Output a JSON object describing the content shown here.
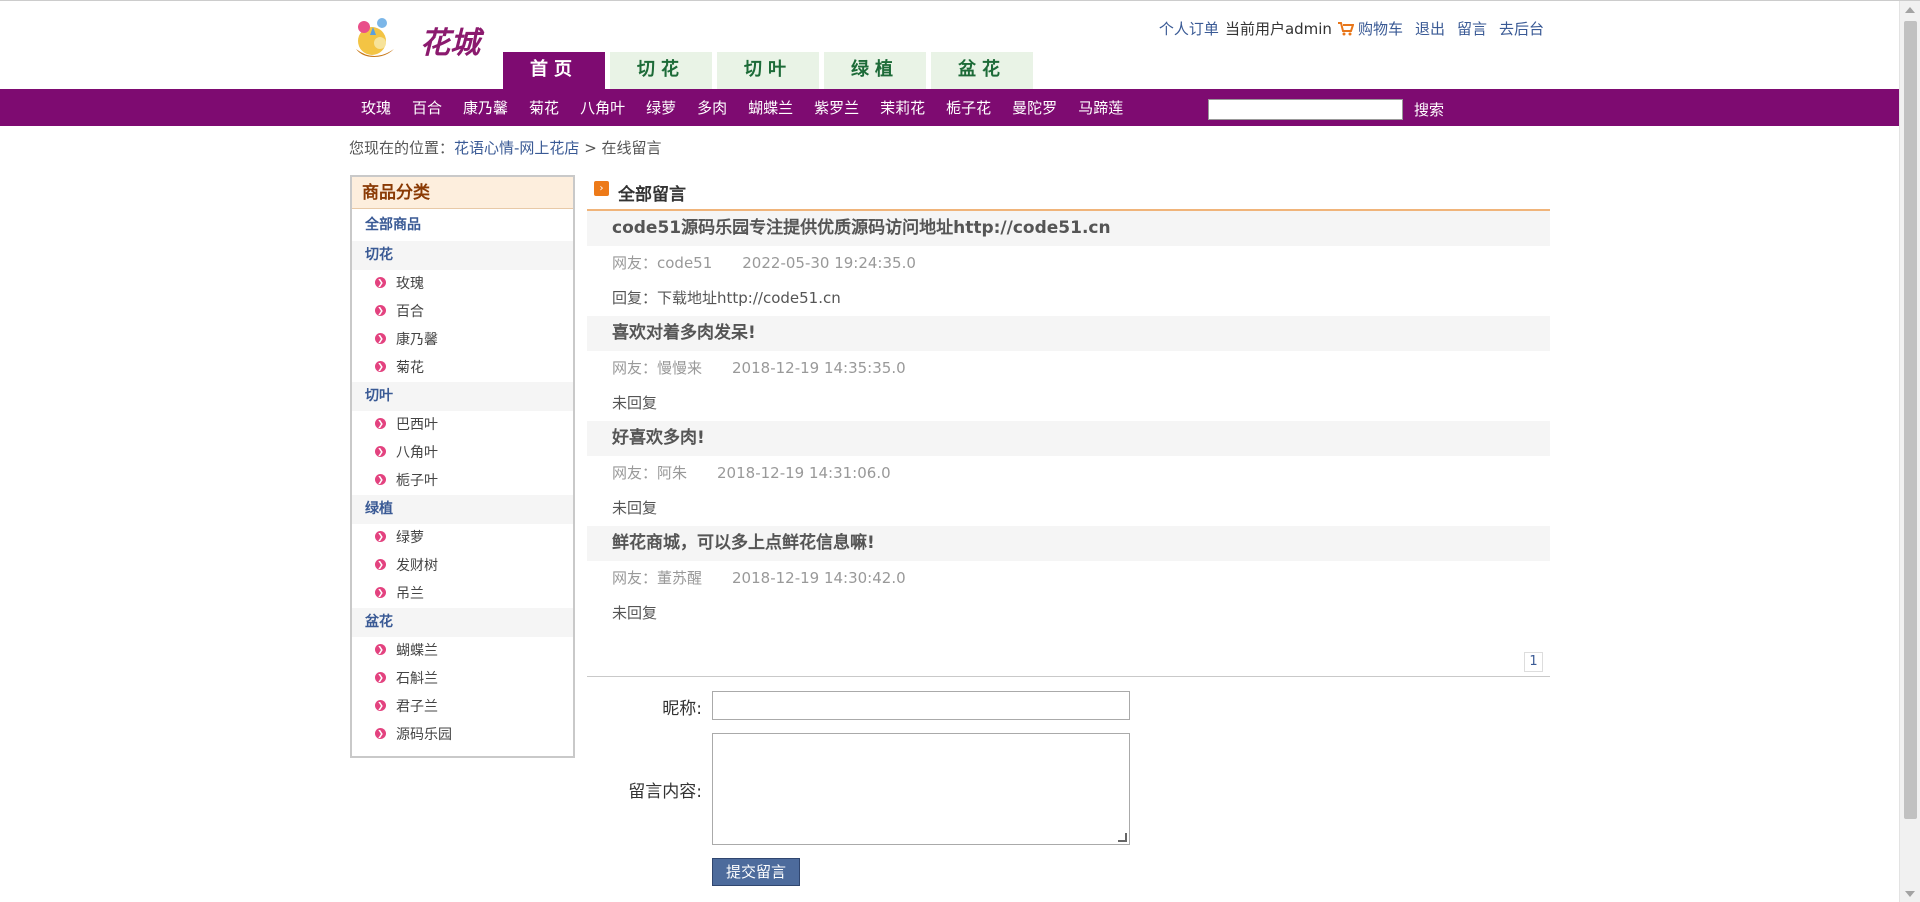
{
  "header": {
    "logo_text": "花城",
    "links": {
      "orders": "个人订单",
      "current_user": "当前用户admin",
      "cart": "购物车",
      "logout": "退出",
      "guestbook": "留言",
      "admin": "去后台"
    }
  },
  "tabs": [
    {
      "label": "首页"
    },
    {
      "label": "切花"
    },
    {
      "label": "切叶"
    },
    {
      "label": "绿植"
    },
    {
      "label": "盆花"
    }
  ],
  "category_bar": {
    "items": [
      "玫瑰",
      "百合",
      "康乃馨",
      "菊花",
      "八角叶",
      "绿萝",
      "多肉",
      "蝴蝶兰",
      "紫罗兰",
      "茉莉花",
      "栀子花",
      "曼陀罗",
      "马蹄莲"
    ],
    "search_value": "",
    "search_button": "搜索"
  },
  "breadcrumb": {
    "prefix": "您现在的位置：",
    "link": "花语心情-网上花店",
    "separator": " > ",
    "current": "在线留言"
  },
  "sidebar": {
    "title": "商品分类",
    "all": "全部商品",
    "groups": [
      {
        "name": "切花",
        "items": [
          "玫瑰",
          "百合",
          "康乃馨",
          "菊花"
        ]
      },
      {
        "name": "切叶",
        "items": [
          "巴西叶",
          "八角叶",
          "栀子叶"
        ]
      },
      {
        "name": "绿植",
        "items": [
          "绿萝",
          "发财树",
          "吊兰"
        ]
      },
      {
        "name": "盆花",
        "items": [
          "蝴蝶兰",
          "石斛兰",
          "君子兰",
          "源码乐园"
        ]
      }
    ]
  },
  "main": {
    "title": "全部留言",
    "messages": [
      {
        "title": "code51源码乐园专注提供优质源码访问地址http://code51.cn",
        "author": "网友：code51",
        "date": "2022-05-30 19:24:35.0",
        "reply": "回复：下载地址http://code51.cn"
      },
      {
        "title": "喜欢对着多肉发呆!",
        "author": "网友：慢慢来",
        "date": "2018-12-19 14:35:35.0",
        "reply": "未回复"
      },
      {
        "title": "好喜欢多肉!",
        "author": "网友：阿朱",
        "date": "2018-12-19 14:31:06.0",
        "reply": "未回复"
      },
      {
        "title": "鲜花商城，可以多上点鲜花信息嘛!",
        "author": "网友：董苏醒",
        "date": "2018-12-19 14:30:42.0",
        "reply": "未回复"
      }
    ],
    "page": "1"
  },
  "form": {
    "nickname_label": "昵称:",
    "nickname_value": "",
    "content_label": "留言内容:",
    "content_value": "",
    "submit": "提交留言"
  },
  "colors": {
    "brand_purple": "#7e0b71",
    "tab_green_bg": "#e9f3e6",
    "link_blue": "#3a5a95",
    "accent_orange": "#f0b47a"
  }
}
